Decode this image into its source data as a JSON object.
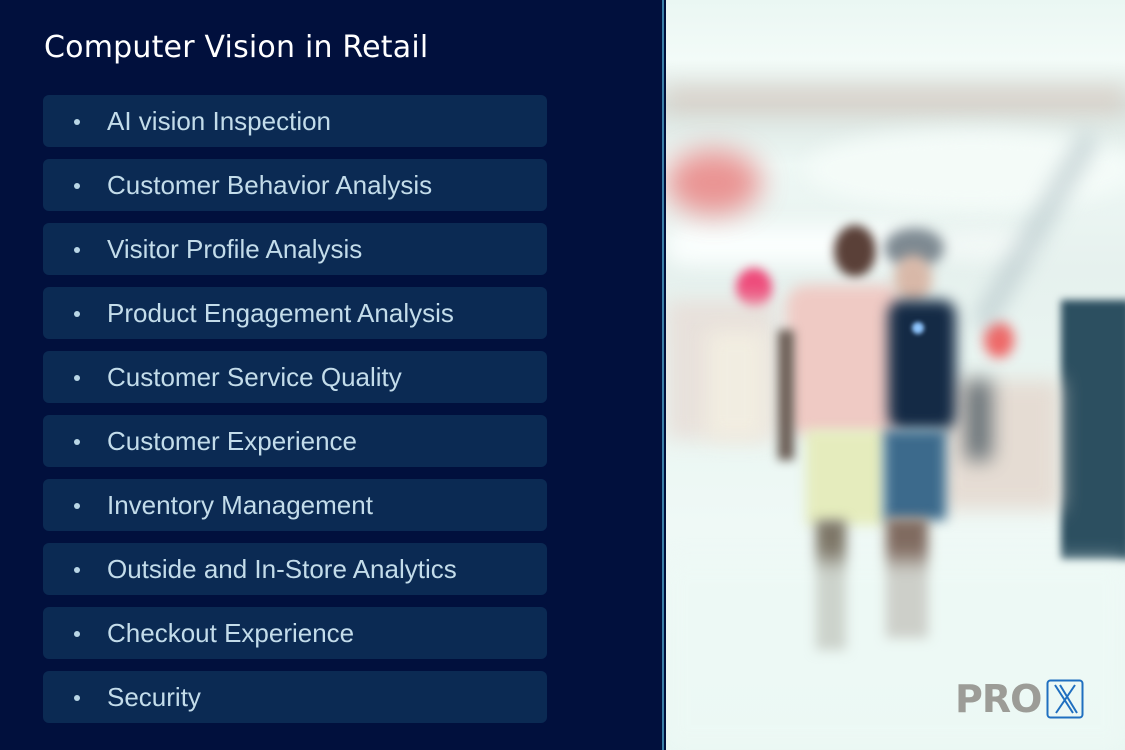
{
  "panel": {
    "title": "Computer Vision in Retail",
    "items": [
      {
        "label": "AI vision Inspection"
      },
      {
        "label": "Customer Behavior Analysis"
      },
      {
        "label": "Visitor Profile Analysis"
      },
      {
        "label": "Product Engagement Analysis"
      },
      {
        "label": "Customer Service Quality"
      },
      {
        "label": "Customer Experience"
      },
      {
        "label": "Inventory Management"
      },
      {
        "label": "Outside and In-Store Analytics"
      },
      {
        "label": "Checkout Experience"
      },
      {
        "label": "Security"
      }
    ]
  },
  "photo": {
    "description": "blurred shopping mall with two people walking"
  },
  "logo": {
    "text": "PRO",
    "mark": "X"
  },
  "colors": {
    "panel_bg": "#01103d",
    "item_bg": "#0b2a53",
    "item_text": "#c3dcea",
    "title_text": "#ffffff",
    "logo_gray": "#9c9c97",
    "logo_blue": "#1f6fc0"
  }
}
